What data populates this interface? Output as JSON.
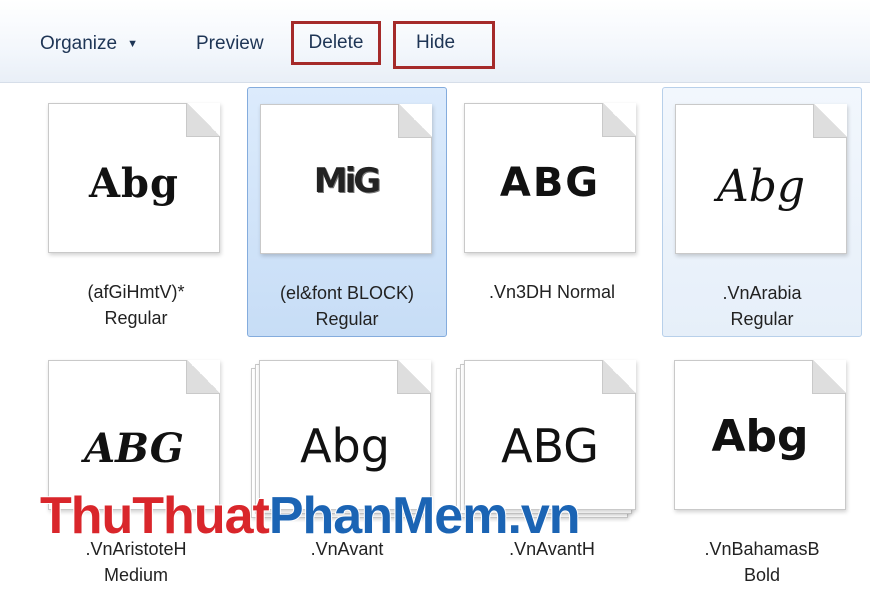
{
  "toolbar": {
    "organize_label": "Organize",
    "preview_label": "Preview",
    "delete_label": "Delete",
    "hide_label": "Hide"
  },
  "fonts": [
    {
      "sample": "Abg",
      "name": "(afGiHmtV)*\nRegular",
      "state": "normal",
      "stacked": false
    },
    {
      "sample": "MiG",
      "name": "(el&font BLOCK)\nRegular",
      "state": "selected",
      "stacked": false
    },
    {
      "sample": "ABG",
      "name": ".Vn3DH  Normal",
      "state": "normal",
      "stacked": false
    },
    {
      "sample": "Abg",
      "name": ".VnArabia\nRegular",
      "state": "hover",
      "stacked": false
    },
    {
      "sample": "ABG",
      "name": ".VnAristoteH\nMedium",
      "state": "normal",
      "stacked": false
    },
    {
      "sample": "Abg",
      "name": ".VnAvant",
      "state": "normal",
      "stacked": true
    },
    {
      "sample": "ABG",
      "name": ".VnAvantH",
      "state": "normal",
      "stacked": true
    },
    {
      "sample": "Abg",
      "name": ".VnBahamasB\nBold",
      "state": "normal",
      "stacked": false
    }
  ],
  "watermark": {
    "part1": "ThuThuat",
    "part2": "PhanMem",
    "part3": ".vn"
  },
  "colors": {
    "highlight_border": "#a52a2a",
    "selected_bg": "#c7ddf6",
    "watermark_red": "#d9262b",
    "watermark_blue": "#1b64b4"
  }
}
